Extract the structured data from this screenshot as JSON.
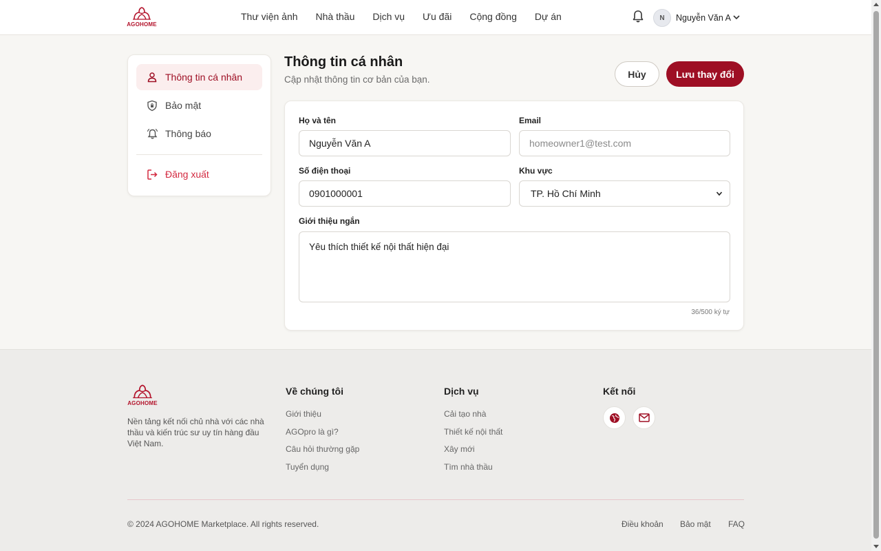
{
  "brand": {
    "name": "AGOHOME",
    "accent": "#9e0f24",
    "logo_icon": "agohome-logo-icon"
  },
  "nav": {
    "items": [
      "Thư viện ảnh",
      "Nhà thầu",
      "Dịch vụ",
      "Ưu đãi",
      "Cộng đồng",
      "Dự án"
    ]
  },
  "user": {
    "initial": "N",
    "name": "Nguyễn Văn A"
  },
  "sidebar": {
    "items": [
      {
        "label": "Thông tin cá nhân",
        "icon": "user-icon",
        "active": true
      },
      {
        "label": "Bảo mật",
        "icon": "shield-icon"
      },
      {
        "label": "Thông báo",
        "icon": "bell-icon"
      }
    ],
    "logout": {
      "label": "Đăng xuất",
      "icon": "logout-icon"
    }
  },
  "main": {
    "title": "Thông tin cá nhân",
    "subtitle": "Cập nhật thông tin cơ bản của bạn.",
    "cancel_label": "Hủy",
    "save_label": "Lưu thay đổi"
  },
  "form": {
    "fullname": {
      "label": "Họ và tên",
      "value": "Nguyễn Văn A"
    },
    "email": {
      "label": "Email",
      "placeholder": "homeowner1@test.com"
    },
    "phone": {
      "label": "Số điện thoại",
      "value": "0901000001"
    },
    "region": {
      "label": "Khu vực",
      "value": "TP. Hồ Chí Minh"
    },
    "bio": {
      "label": "Giới thiệu ngắn",
      "value": "Yêu thích thiết kế nội thất hiện đại",
      "counter": "36/500 ký tự"
    }
  },
  "footer": {
    "description": "Nền tảng kết nối chủ nhà với các nhà thầu và kiến trúc sư uy tín hàng đầu Việt Nam.",
    "about": {
      "title": "Về chúng tôi",
      "links": [
        "Giới thiệu",
        "AGOpro là gì?",
        "Câu hỏi thường gặp",
        "Tuyển dụng"
      ]
    },
    "services": {
      "title": "Dịch vụ",
      "links": [
        "Cải tạo nhà",
        "Thiết kế nội thất",
        "Xây mới",
        "Tìm nhà thầu"
      ]
    },
    "connect": {
      "title": "Kết nối",
      "icons": [
        "globe-icon",
        "mail-icon"
      ]
    },
    "copyright": "© 2024 AGOHOME Marketplace. All rights reserved.",
    "bottom_links": [
      "Điều khoản",
      "Bảo mật",
      "FAQ"
    ]
  }
}
